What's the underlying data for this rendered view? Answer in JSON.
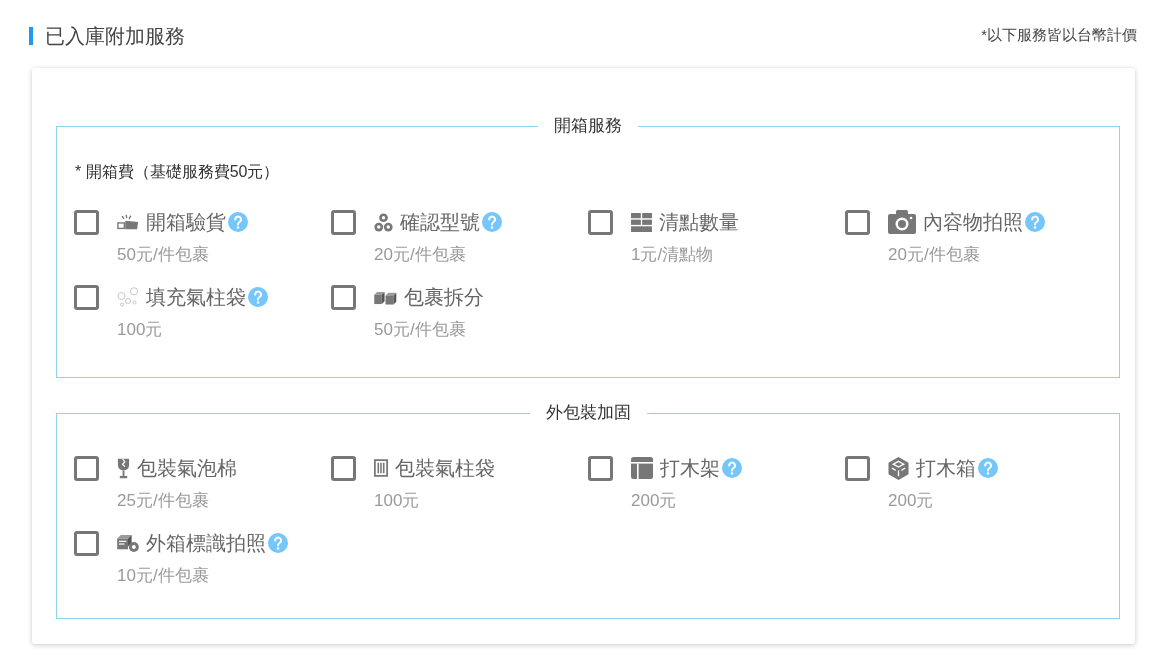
{
  "header": {
    "title": "已入庫附加服務",
    "note": "*以下服務皆以台幣計價"
  },
  "sections": [
    {
      "title": "開箱服務",
      "note": "* 開箱費（基礎服務費50元）",
      "items": [
        {
          "label": "開箱驗貨",
          "price": "50元/件包裹",
          "checked": false,
          "help": true
        },
        {
          "label": "確認型號",
          "price": "20元/件包裹",
          "checked": false,
          "help": true
        },
        {
          "label": "清點數量",
          "price": "1元/清點物",
          "checked": false,
          "help": false
        },
        {
          "label": "內容物拍照",
          "price": "20元/件包裹",
          "checked": false,
          "help": true
        },
        {
          "label": "填充氣柱袋",
          "price": "100元",
          "checked": false,
          "help": true
        },
        {
          "label": "包裹拆分",
          "price": "50元/件包裹",
          "checked": false,
          "help": false
        }
      ]
    },
    {
      "title": "外包裝加固",
      "items": [
        {
          "label": "包裝氣泡棉",
          "price": "25元/件包裹",
          "checked": false,
          "help": false
        },
        {
          "label": "包裝氣柱袋",
          "price": "100元",
          "checked": false,
          "help": false
        },
        {
          "label": "打木架",
          "price": "200元",
          "checked": false,
          "help": true
        },
        {
          "label": "打木箱",
          "price": "200元",
          "checked": false,
          "help": true
        },
        {
          "label": "外箱標識拍照",
          "price": "10元/件包裹",
          "checked": false,
          "help": true
        }
      ]
    }
  ]
}
